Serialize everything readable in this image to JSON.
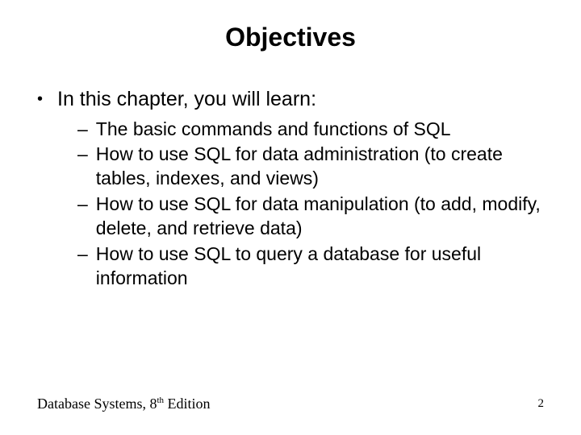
{
  "title": "Objectives",
  "intro": "In this chapter, you will learn:",
  "items": [
    "The basic commands and functions of SQL",
    "How to use SQL for data administration (to create tables, indexes, and views)",
    "How to use SQL for data manipulation (to add, modify, delete, and retrieve data)",
    "How to use SQL to query a database for useful information"
  ],
  "footer": {
    "prefix": "Database Systems, 8",
    "sup": "th",
    "suffix": " Edition"
  },
  "page_number": "2"
}
